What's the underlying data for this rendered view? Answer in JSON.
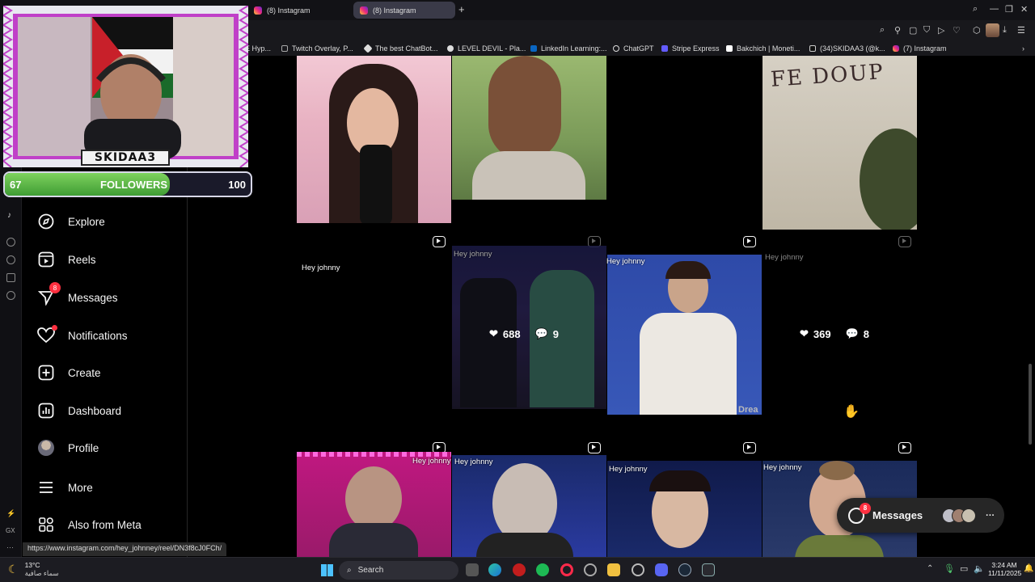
{
  "tabs": [
    {
      "label": "(8) Instagram"
    },
    {
      "label": "(8) Instagram"
    }
  ],
  "bookmarks": [
    {
      "label": "E Hyp..."
    },
    {
      "label": "Twitch Overlay, P..."
    },
    {
      "label": "The best ChatBot..."
    },
    {
      "label": "LEVEL DEVIL - Pla..."
    },
    {
      "label": "LinkedIn Learning:..."
    },
    {
      "label": "ChatGPT"
    },
    {
      "label": "Stripe Express"
    },
    {
      "label": "Bakchich | Moneti..."
    },
    {
      "label": "(34)SKIDAA3 (@k..."
    },
    {
      "label": "(7) Instagram"
    }
  ],
  "overlay": {
    "streamer_name": "SKIDAA3",
    "followers_current": "67",
    "followers_label": "FOLLOWERS",
    "followers_goal": "100",
    "followers_progress": 0.67
  },
  "sidebar": {
    "items": [
      {
        "label": "Explore",
        "icon": "compass-icon"
      },
      {
        "label": "Reels",
        "icon": "reels-icon"
      },
      {
        "label": "Messages",
        "icon": "messenger-icon",
        "badge": "8"
      },
      {
        "label": "Notifications",
        "icon": "heart-icon"
      },
      {
        "label": "Create",
        "icon": "plus-square-icon"
      },
      {
        "label": "Dashboard",
        "icon": "dashboard-icon"
      },
      {
        "label": "Profile",
        "icon": "avatar"
      },
      {
        "label": "More",
        "icon": "menu-icon"
      },
      {
        "label": "Also from Meta",
        "icon": "meta-grid-icon"
      }
    ]
  },
  "grid": {
    "caption": "Hey johnny",
    "watermark_partial": "Drea",
    "stats": [
      {
        "likes": "688",
        "comments": "9"
      },
      {
        "likes": "369",
        "comments": "8"
      }
    ]
  },
  "messages_pill": {
    "label": "Messages",
    "badge": "8"
  },
  "status_url": "https://www.instagram.com/hey_johnney/reel/DN3f8cJ0FCh/",
  "taskbar": {
    "weather_temp": "13°C",
    "weather_desc": "سماء صافية",
    "search_label": "Search",
    "time": "3:24 AM",
    "date": "11/11/2025"
  },
  "colors": {
    "accent_red": "#ff3040",
    "follower_bar": "#5fbf4a",
    "overlay_frame": "#c040c8"
  }
}
